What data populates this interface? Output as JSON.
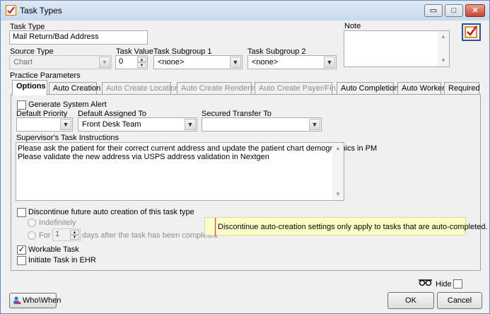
{
  "window": {
    "title": "Task Types",
    "minimize": "▭",
    "maximize": "□",
    "close": "✕"
  },
  "form": {
    "task_type_label": "Task Type",
    "task_type_value": "Mail Return/Bad Address",
    "note_label": "Note",
    "note_value": "",
    "source_type_label": "Source Type",
    "source_type_value": "Chart",
    "task_value_label": "Task Value",
    "task_value": "0",
    "subgroup1_label": "Task Subgroup 1",
    "subgroup1_value": "<none>",
    "subgroup2_label": "Task Subgroup 2",
    "subgroup2_value": "<none>",
    "practice_params_label": "Practice Parameters"
  },
  "tabs": [
    {
      "label": "Options",
      "state": "active"
    },
    {
      "label": "Auto Creation",
      "state": "enabled"
    },
    {
      "label": "Auto Create Location",
      "state": "disabled"
    },
    {
      "label": "Auto Create Rendering",
      "state": "disabled"
    },
    {
      "label": "Auto Create Payer/Fin...",
      "state": "disabled"
    },
    {
      "label": "Auto Completion",
      "state": "enabled"
    },
    {
      "label": "Auto Worker",
      "state": "enabled"
    },
    {
      "label": "Required",
      "state": "enabled"
    }
  ],
  "options": {
    "generate_alert_label": "Generate System Alert",
    "generate_alert_checked": false,
    "default_priority_label": "Default Priority",
    "default_priority_value": "",
    "default_assigned_label": "Default Assigned To",
    "default_assigned_value": "Front Desk Team",
    "secured_transfer_label": "Secured Transfer To",
    "secured_transfer_value": "",
    "supervisor_label": "Supervisor's Task Instructions",
    "supervisor_line1": "Please ask the patient for their correct current address and update the patient chart demographics in PM",
    "supervisor_line2": "Please validate the new address via USPS address validation in Nextgen",
    "discontinue_label": "Discontinue future auto creation of this task type",
    "discontinue_checked": false,
    "indefinitely_label": "Indefinitely",
    "for_label": "For",
    "for_days_value": "1",
    "days_after_label": "days after the task has been completed",
    "tooltip_text": "Discontinue auto-creation settings only apply to tasks that are auto-completed.",
    "workable_label": "Workable Task",
    "workable_checked": true,
    "initiate_ehr_label": "Initiate Task in EHR",
    "initiate_ehr_checked": false
  },
  "footer": {
    "hide_label": "Hide",
    "hide_checked": false,
    "who_when_label": "Who\\When",
    "ok_label": "OK",
    "cancel_label": "Cancel"
  },
  "glyphs": {
    "dropdown": "▼",
    "spin_up": "▲",
    "spin_down": "▼",
    "check": "✓"
  }
}
